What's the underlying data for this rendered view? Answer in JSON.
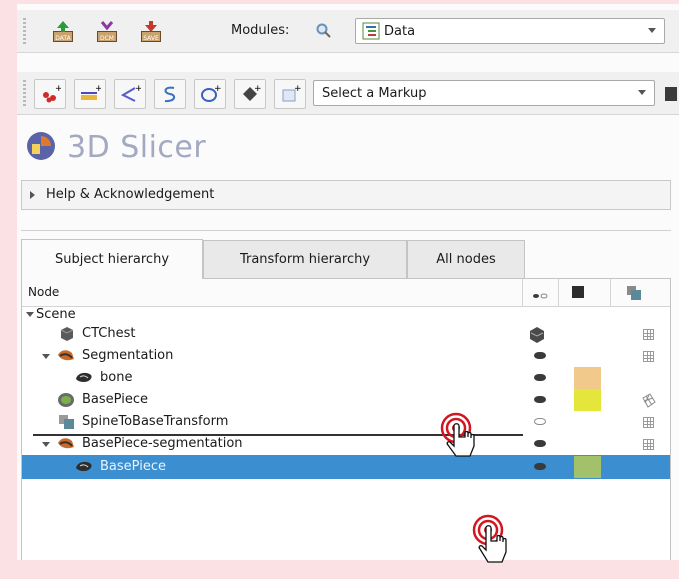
{
  "toolbar1": {
    "buttons": [
      {
        "label": "DATA",
        "icon": "data-load-icon"
      },
      {
        "label": "DCM",
        "icon": "dicom-icon"
      },
      {
        "label": "SAVE",
        "icon": "save-icon"
      }
    ],
    "modules_label": "Modules:",
    "module_selected": "Data"
  },
  "toolbar2": {
    "markup_icons": [
      "fiducial-icon",
      "line-icon",
      "angle-icon",
      "open-curve-icon",
      "closed-curve-icon",
      "plane-icon",
      "roi-icon"
    ],
    "markup_select": "Select a Markup"
  },
  "app": {
    "title": "3D Slicer"
  },
  "help": {
    "label": "Help & Acknowledgement"
  },
  "tabs": [
    "Subject hierarchy",
    "Transform hierarchy",
    "All nodes"
  ],
  "tree": {
    "column_node": "Node",
    "rows": [
      {
        "name": "Scene",
        "level": 0,
        "expanded": true
      },
      {
        "name": "CTChest",
        "level": 1,
        "icon": "volume-icon",
        "vis": "volume"
      },
      {
        "name": "Segmentation",
        "level": 1,
        "icon": "segmentation-icon",
        "expanded": true,
        "vis": "on"
      },
      {
        "name": "bone",
        "level": 2,
        "icon": "segment-icon",
        "vis": "on",
        "color": "#f0c98b"
      },
      {
        "name": "BasePiece",
        "level": 1,
        "icon": "model-icon",
        "vis": "on",
        "color": "#e4e63b"
      },
      {
        "name": "SpineToBaseTransform",
        "level": 1,
        "icon": "transform-icon",
        "vis": "off"
      },
      {
        "name": "BasePiece-segmentation",
        "level": 1,
        "icon": "segmentation-icon",
        "expanded": true,
        "vis": "on"
      },
      {
        "name": "BasePiece",
        "level": 2,
        "icon": "segment-icon",
        "vis": "on",
        "color": "#a3c06a",
        "selected": true
      }
    ]
  },
  "colors": {
    "background": "#fbe1e3",
    "selection": "#3b8fd1",
    "cursor_ring": "#d2161f"
  }
}
